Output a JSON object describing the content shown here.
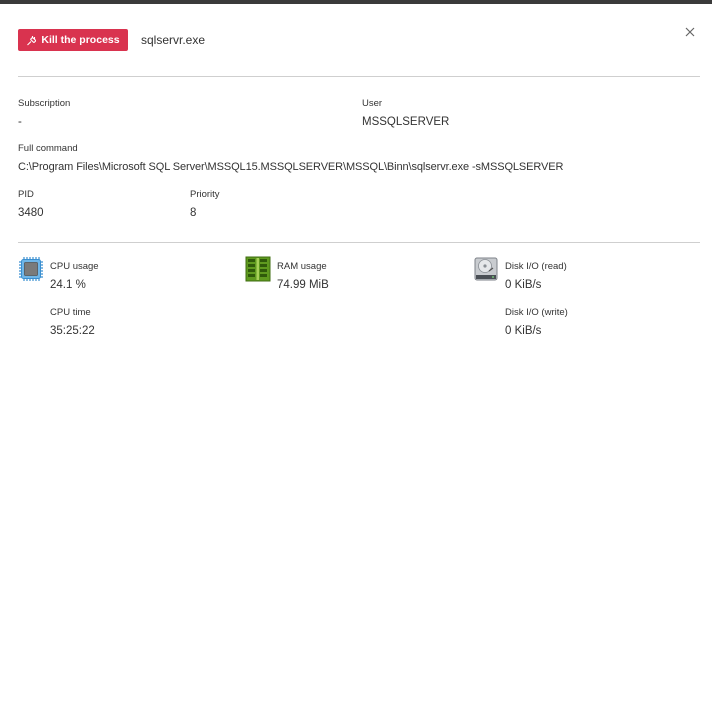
{
  "header": {
    "kill_label": "Kill the process",
    "process_name": "sqlservr.exe"
  },
  "details": {
    "subscription_label": "Subscription",
    "subscription_value": "-",
    "user_label": "User",
    "user_value": "MSSQLSERVER",
    "full_command_label": "Full command",
    "full_command_value": "C:\\Program Files\\Microsoft SQL Server\\MSSQL15.MSSQLSERVER\\MSSQL\\Binn\\sqlservr.exe -sMSSQLSERVER",
    "pid_label": "PID",
    "pid_value": "3480",
    "priority_label": "Priority",
    "priority_value": "8"
  },
  "metrics": {
    "cpu_usage_label": "CPU usage",
    "cpu_usage_value": "24.1 %",
    "cpu_time_label": "CPU time",
    "cpu_time_value": "35:25:22",
    "ram_usage_label": "RAM usage",
    "ram_usage_value": "74.99 MiB",
    "disk_read_label": "Disk I/O (read)",
    "disk_read_value": "0 KiB/s",
    "disk_write_label": "Disk I/O (write)",
    "disk_write_value": "0 KiB/s"
  },
  "icons": {
    "kill": "power-plug-icon",
    "close": "close-icon",
    "cpu": "cpu-chip-icon",
    "ram": "ram-module-icon",
    "disk": "hard-drive-icon"
  },
  "colors": {
    "accent": "#d9334f",
    "divider": "#cfcfcf"
  }
}
